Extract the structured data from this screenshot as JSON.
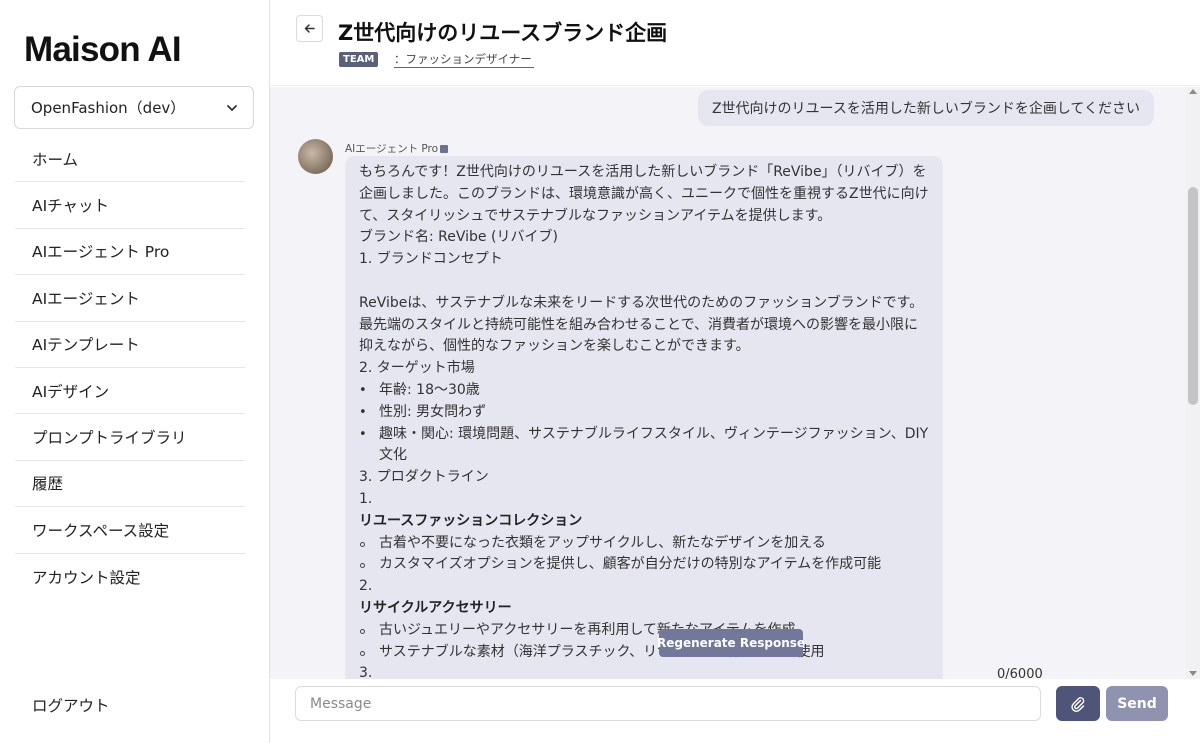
{
  "app": {
    "logo": "Maison AI"
  },
  "workspace": {
    "selected": "OpenFashion（dev）"
  },
  "nav": {
    "items": [
      {
        "label": "ホーム"
      },
      {
        "label": "AIチャット"
      },
      {
        "label": "AIエージェント Pro"
      },
      {
        "label": "AIエージェント"
      },
      {
        "label": "AIテンプレート"
      },
      {
        "label": "AIデザイン"
      },
      {
        "label": "プロンプトライブラリ"
      },
      {
        "label": "履歴"
      },
      {
        "label": "ワークスペース設定"
      },
      {
        "label": "アカウント設定"
      }
    ],
    "logout": "ログアウト"
  },
  "header": {
    "title": "Z世代向けのリユースブランド企画",
    "badge": "TEAM",
    "role": "：ファッションデザイナー"
  },
  "chat": {
    "user_message": "Z世代向けのリユースを活用した新しいブランドを企画してください",
    "agent_name": "AIエージェント Pro",
    "ai_lines": [
      {
        "t": "p",
        "text": "もちろんです！Z世代向けのリユースを活用した新しいブランド「ReVibe」（リバイブ）を企画しました。このブランドは、環境意識が高く、ユニークで個性を重視するZ世代に向けて、スタイリッシュでサステナブルなファッションアイテムを提供します。"
      },
      {
        "t": "p",
        "text": "ブランド名: ReVibe (リバイブ)"
      },
      {
        "t": "p",
        "text": "1. ブランドコンセプト"
      },
      {
        "t": "gap",
        "text": ""
      },
      {
        "t": "p",
        "text": "ReVibeは、サステナブルな未来をリードする次世代のためのファッションブランドです。最先端のスタイルと持続可能性を組み合わせることで、消費者が環境への影響を最小限に抑えながら、個性的なファッションを楽しむことができます。"
      },
      {
        "t": "p",
        "text": "2. ターゲット市場"
      },
      {
        "t": "bul",
        "text": "年齢: 18〜30歳"
      },
      {
        "t": "bul",
        "text": "性別: 男女問わず"
      },
      {
        "t": "bul",
        "text": "趣味・関心: 環境問題、サステナブルライフスタイル、ヴィンテージファッション、DIY文化"
      },
      {
        "t": "p",
        "text": "3. プロダクトライン"
      },
      {
        "t": "p",
        "text": "1."
      },
      {
        "t": "b",
        "text": "リユースファッションコレクション"
      },
      {
        "t": "circ",
        "text": "古着や不要になった衣類をアップサイクルし、新たなデザインを加える"
      },
      {
        "t": "circ",
        "text": "カスタマイズオプションを提供し、顧客が自分だけの特別なアイテムを作成可能"
      },
      {
        "t": "p",
        "text": "2."
      },
      {
        "t": "b",
        "text": "リサイクルアクセサリー"
      },
      {
        "t": "circ",
        "text": "古いジュエリーやアクセサリーを再利用して新たなアイテムを作成"
      },
      {
        "t": "circ",
        "text": "サステナブルな素材（海洋プラスチック、リサイクル素材など）を使用"
      },
      {
        "t": "p",
        "text": "3."
      }
    ],
    "regenerate_label": "Regenerate Response"
  },
  "composer": {
    "placeholder": "Message",
    "value": "",
    "counter": "0/6000",
    "send_label": "Send"
  },
  "colors": {
    "accent": "#4f5479",
    "send_button": "#8f93b0",
    "badge": "#5a6079",
    "bubble": "#e5e6ef",
    "chat_bg": "#f4f4f8"
  }
}
